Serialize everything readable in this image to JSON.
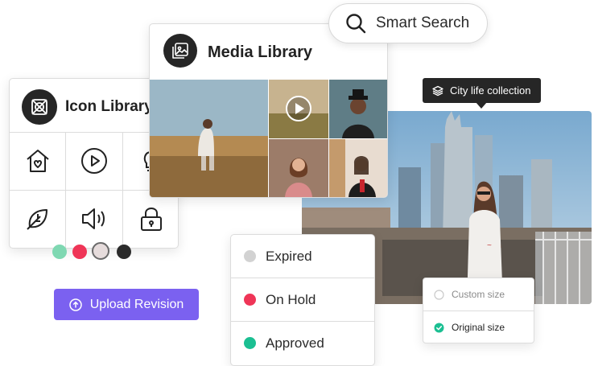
{
  "search": {
    "label": "Smart Search"
  },
  "media_library": {
    "title": "Media Library"
  },
  "icon_library": {
    "title": "Icon Library",
    "icons": [
      "home-heart-icon",
      "play-circle-icon",
      "lightbulb-icon",
      "leaf-icon",
      "speaker-icon",
      "lock-icon"
    ]
  },
  "swatches": [
    "#7fd8b2",
    "#ef3557",
    "#e6dcdc",
    "#2b2b2b"
  ],
  "upload": {
    "label": "Upload Revision",
    "color": "#7b61f0"
  },
  "tooltip": {
    "label": "City life collection"
  },
  "status_list": {
    "items": [
      {
        "label": "Expired",
        "color": "#d2d2d2"
      },
      {
        "label": "On Hold",
        "color": "#ef3557"
      },
      {
        "label": "Approved",
        "color": "#1bbf92"
      }
    ]
  },
  "size_options": {
    "items": [
      {
        "label": "Custom size",
        "selected": false
      },
      {
        "label": "Original size",
        "selected": true
      }
    ],
    "accent": "#1bbf92"
  }
}
